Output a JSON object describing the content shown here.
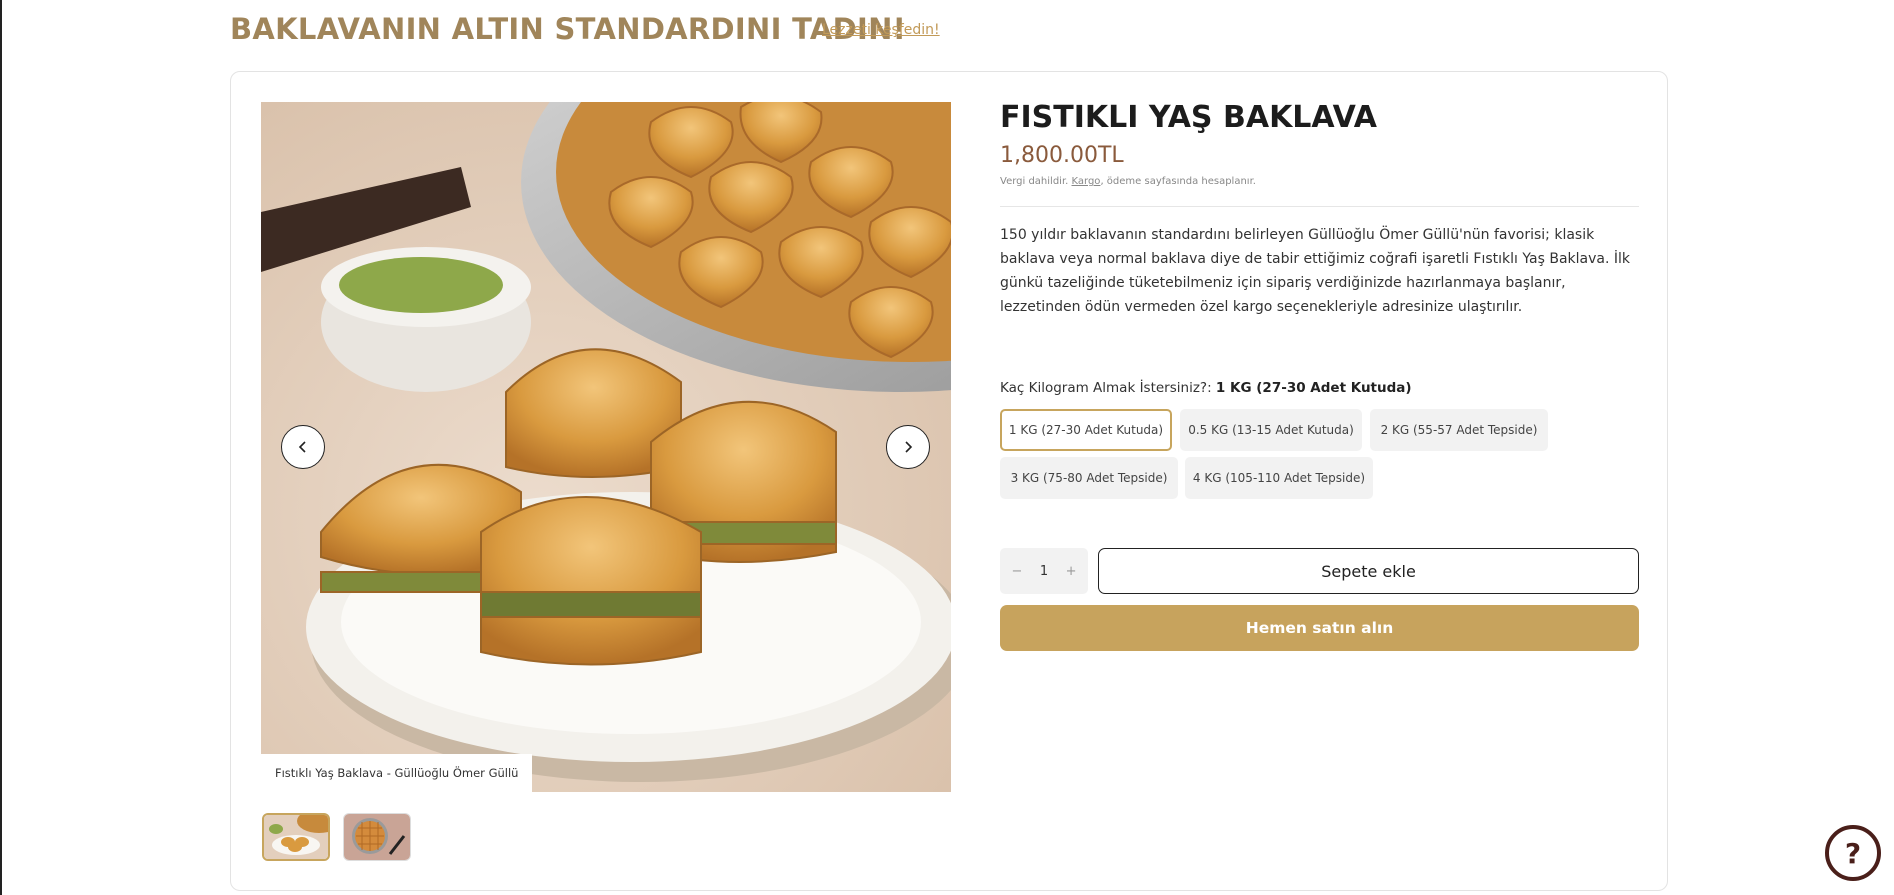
{
  "hero": {
    "title": "BAKLAVANIN ALTIN STANDARDINI TADIN!",
    "link": "Lezzeti keşfedin!"
  },
  "gallery": {
    "caption": "Fıstıklı Yaş Baklava - Güllüoğlu Ömer Güllü",
    "prev_icon": "chevron-left-icon",
    "next_icon": "chevron-right-icon",
    "thumbnails": [
      "baklava-plate-thumbnail",
      "baklava-tray-thumbnail"
    ]
  },
  "product": {
    "title": "FISTIKLI YAŞ BAKLAVA",
    "price": "1,800.00TL",
    "tax_prefix": "Vergi dahildir.",
    "tax_link": "Kargo",
    "tax_suffix": ", ödeme sayfasında hesaplanır.",
    "description": "150 yıldır baklavanın standardını belirleyen Güllüoğlu Ömer Güllü'nün favorisi; klasik baklava veya normal baklava diye de tabir ettiğimiz coğrafi işaretli Fıstıklı Yaş Baklava. İlk günkü tazeliğinde tüketebilmeniz için sipariş verdiğinizde hazırlanmaya başlanır, lezzetinden ödün vermeden özel kargo seçenekleriyle adresinize ulaştırılır."
  },
  "options": {
    "label": "Kaç Kilogram Almak İstersiniz?:",
    "selected": "1 KG (27-30 Adet Kutuda)",
    "items": [
      "1 KG (27-30 Adet Kutuda)",
      "0.5 KG (13-15 Adet Kutuda)",
      "2 KG (55-57 Adet Tepside)",
      "3 KG (75-80 Adet Tepside)",
      "4 KG (105-110 Adet Tepside)"
    ]
  },
  "purchase": {
    "minus": "−",
    "quantity": "1",
    "plus": "+",
    "add_to_cart": "Sepete ekle",
    "buy_now": "Hemen satın alın"
  },
  "help": {
    "icon": "question-mark-icon",
    "label": "?"
  },
  "colors": {
    "accent_gold": "#c7a35d",
    "hero_title": "#a0855a",
    "price": "#8a5a3c",
    "help_border": "#4a1f1a"
  }
}
